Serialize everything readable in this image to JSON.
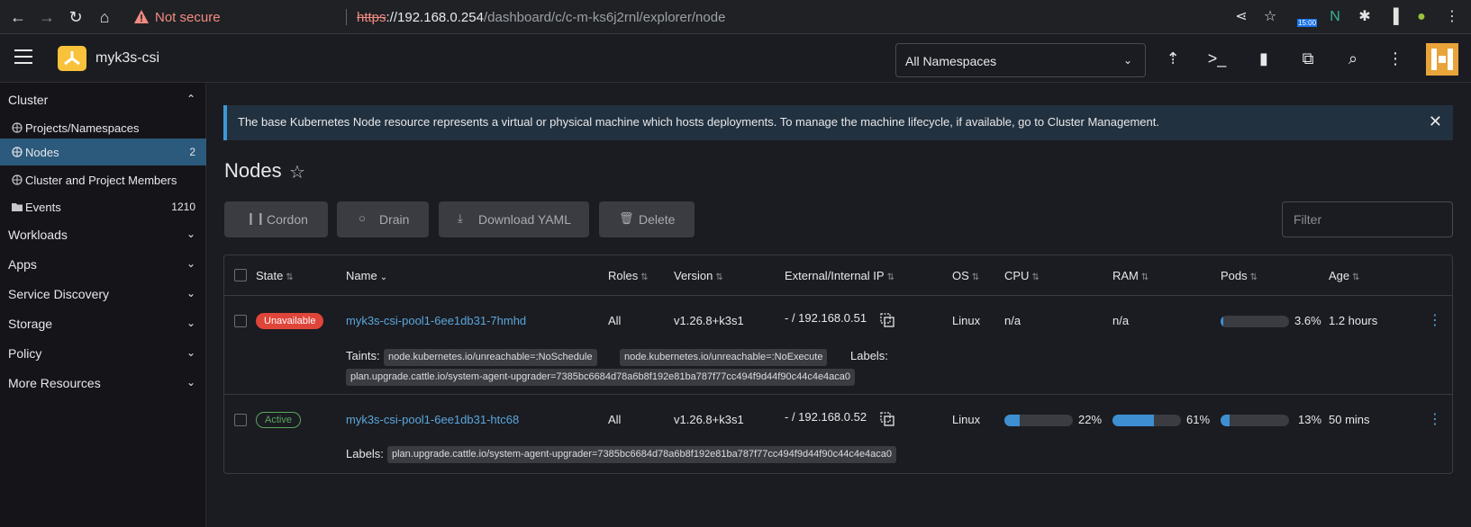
{
  "browser": {
    "security_label": "Not secure",
    "url_scheme": "https",
    "url_host": "://192.168.0.254",
    "url_path": "/dashboard/c/c-m-ks6j2rnl/explorer/node",
    "ext_badge": "15:00"
  },
  "header": {
    "cluster_name": "myk3s-csi",
    "namespace_select": "All Namespaces"
  },
  "sidebar": {
    "cluster_label": "Cluster",
    "items": [
      {
        "label": "Projects/Namespaces",
        "count": ""
      },
      {
        "label": "Nodes",
        "count": "2"
      },
      {
        "label": "Cluster and Project Members",
        "count": ""
      },
      {
        "label": "Events",
        "count": "1210"
      }
    ],
    "groups": [
      "Workloads",
      "Apps",
      "Service Discovery",
      "Storage",
      "Policy",
      "More Resources"
    ]
  },
  "banner": {
    "text": "The base Kubernetes Node resource represents a virtual or physical machine which hosts deployments. To manage the machine lifecycle, if available, go to Cluster Management."
  },
  "page": {
    "title": "Nodes"
  },
  "toolbar": {
    "cordon": "Cordon",
    "drain": "Drain",
    "download_yaml": "Download YAML",
    "delete": "Delete",
    "filter_placeholder": "Filter"
  },
  "table": {
    "headers": [
      "State",
      "Name",
      "Roles",
      "Version",
      "External/Internal IP",
      "OS",
      "CPU",
      "RAM",
      "Pods",
      "Age"
    ],
    "rows": [
      {
        "state": "Unavailable",
        "name": "myk3s-csi-pool1-6ee1db31-7hmhd",
        "roles": "All",
        "version": "v1.26.8+k3s1",
        "ip": "- / 192.168.0.51",
        "os": "Linux",
        "cpu": "n/a",
        "ram": "n/a",
        "pods_pct": "3.6%",
        "pods_fraction": 0.036,
        "age": "1.2 hours",
        "taints_label": "Taints:",
        "taints": [
          "node.kubernetes.io/unreachable=:NoSchedule",
          "node.kubernetes.io/unreachable=:NoExecute"
        ],
        "labels_label": "Labels:",
        "labels": [
          "plan.upgrade.cattle.io/system-agent-upgrader=7385bc6684d78a6b8f192e81ba787f77cc494f9d44f90c44c4e4aca0"
        ]
      },
      {
        "state": "Active",
        "name": "myk3s-csi-pool1-6ee1db31-htc68",
        "roles": "All",
        "version": "v1.26.8+k3s1",
        "ip": "- / 192.168.0.52",
        "os": "Linux",
        "cpu_pct": "22%",
        "cpu_fraction": 0.22,
        "ram_pct": "61%",
        "ram_fraction": 0.61,
        "pods_pct": "13%",
        "pods_fraction": 0.13,
        "age": "50 mins",
        "labels_label": "Labels:",
        "labels": [
          "plan.upgrade.cattle.io/system-agent-upgrader=7385bc6684d78a6b8f192e81ba787f77cc494f9d44f90c44c4e4aca0"
        ]
      }
    ]
  },
  "colors": {
    "accent": "#3d98d3",
    "error": "#e0453a",
    "success": "#5aa55f",
    "active_nav": "#2b5a7d"
  }
}
